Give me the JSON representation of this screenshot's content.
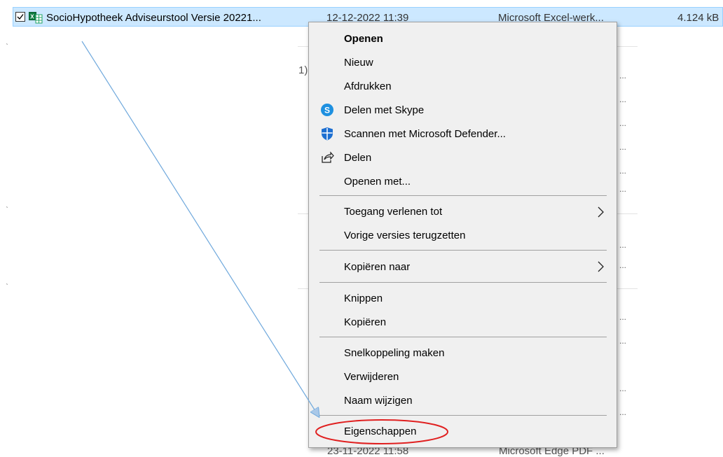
{
  "file_row": {
    "name": "SocioHypotheek Adviseurstool Versie 20221...",
    "date": "12-12-2022 11:39",
    "type": "Microsoft Excel-werk...",
    "size": "4.124 kB"
  },
  "background": {
    "fragment_1x": "1)",
    "bottom_date": "23-11-2022 11:58",
    "bottom_type": "Microsoft Edge PDF ...",
    "ellipsis": "..."
  },
  "context_menu": {
    "open": "Openen",
    "new": "Nieuw",
    "print": "Afdrukken",
    "share_skype": "Delen met Skype",
    "scan_defender": "Scannen met Microsoft Defender...",
    "share": "Delen",
    "open_with": "Openen met...",
    "give_access": "Toegang verlenen tot",
    "restore_versions": "Vorige versies terugzetten",
    "send_to": "Kopiëren naar",
    "cut": "Knippen",
    "copy": "Kopiëren",
    "create_shortcut": "Snelkoppeling maken",
    "delete": "Verwijderen",
    "rename": "Naam wijzigen",
    "properties": "Eigenschappen"
  },
  "icons": {
    "skype": "skype-icon",
    "defender": "defender-shield-icon",
    "share": "share-icon",
    "excel": "excel-file-icon"
  },
  "colors": {
    "selection": "#cce8ff",
    "annotation_arrow": "#6fa8dc",
    "annotation_circle": "#e02020"
  }
}
